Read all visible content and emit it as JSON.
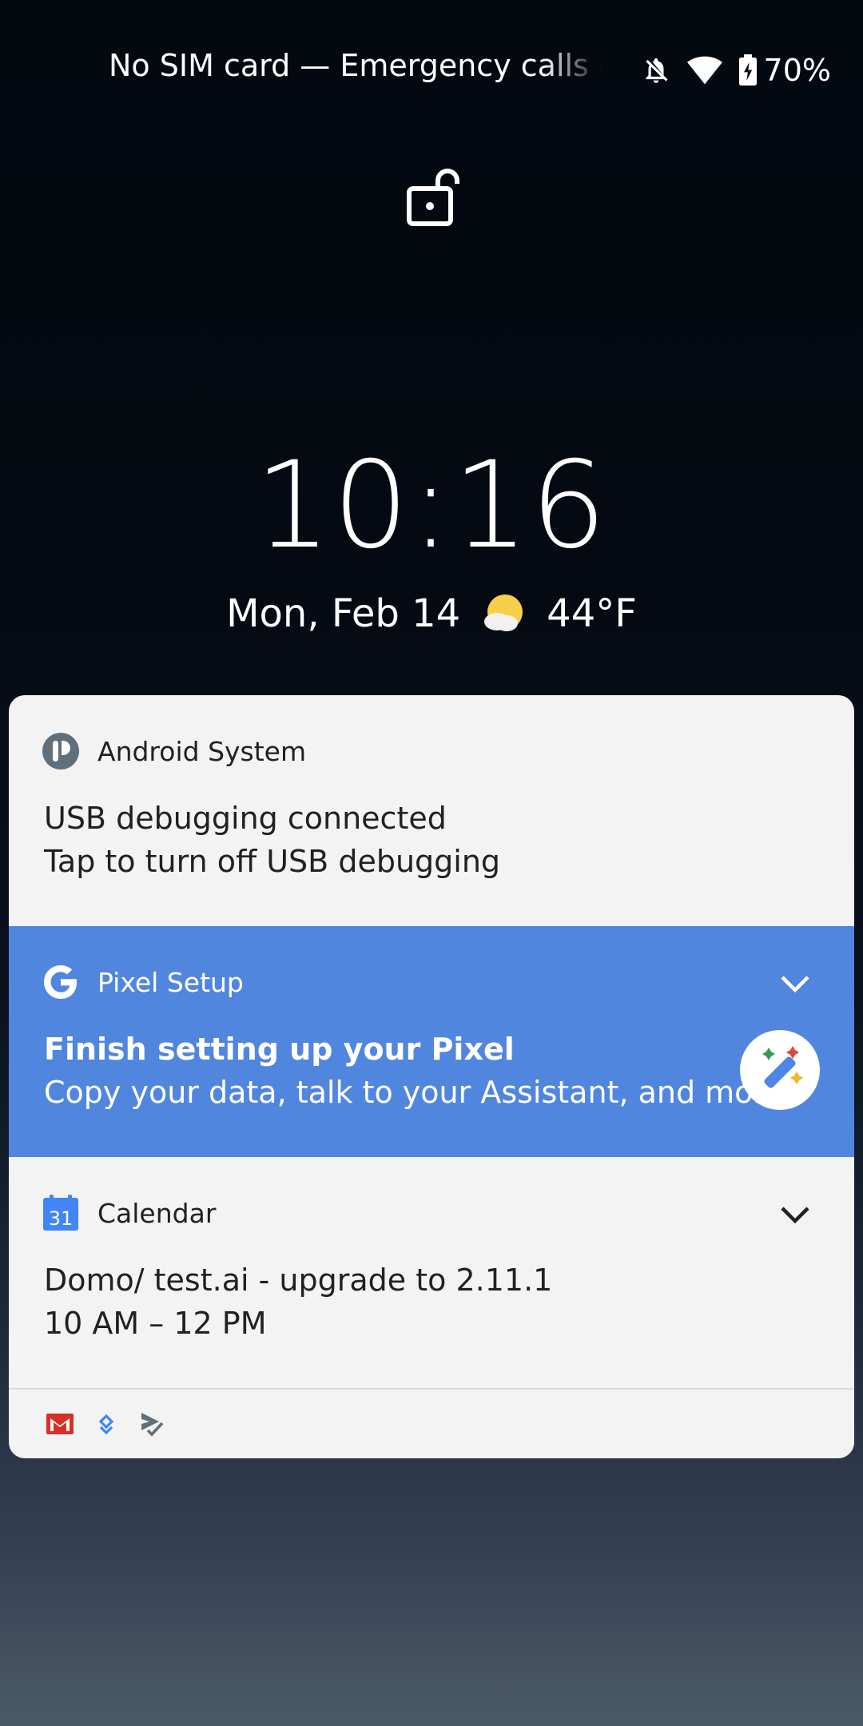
{
  "status_bar": {
    "carrier_text": "No SIM card — Emergency calls or",
    "battery_percent": "70%",
    "icons": [
      "bell-off-icon",
      "wifi-icon",
      "battery-charging-icon"
    ]
  },
  "lockscreen": {
    "lock_icon": "unlocked-padlock-icon",
    "time": "10:16",
    "date": "Mon, Feb 14",
    "weather_icon": "partly-sunny-icon",
    "temperature": "44°F"
  },
  "notifications": [
    {
      "app": "Android System",
      "icon": "android-system-icon",
      "title": "USB debugging connected",
      "text": "Tap to turn off USB debugging"
    },
    {
      "app": "Pixel Setup",
      "icon": "google-g-icon",
      "title": "Finish setting up your Pixel",
      "text": "Copy your data, talk to your Assistant, and more",
      "badge_icon": "magic-wand-icon",
      "accent_color": "#5186de"
    },
    {
      "app": "Calendar",
      "icon": "calendar-31-icon",
      "icon_label": "31",
      "title": "Domo/ test.ai - upgrade to 2.11.1",
      "text": "10 AM – 12 PM"
    }
  ],
  "footer_icons": [
    "gmail-icon",
    "google-fit-icon",
    "tasks-icon"
  ]
}
